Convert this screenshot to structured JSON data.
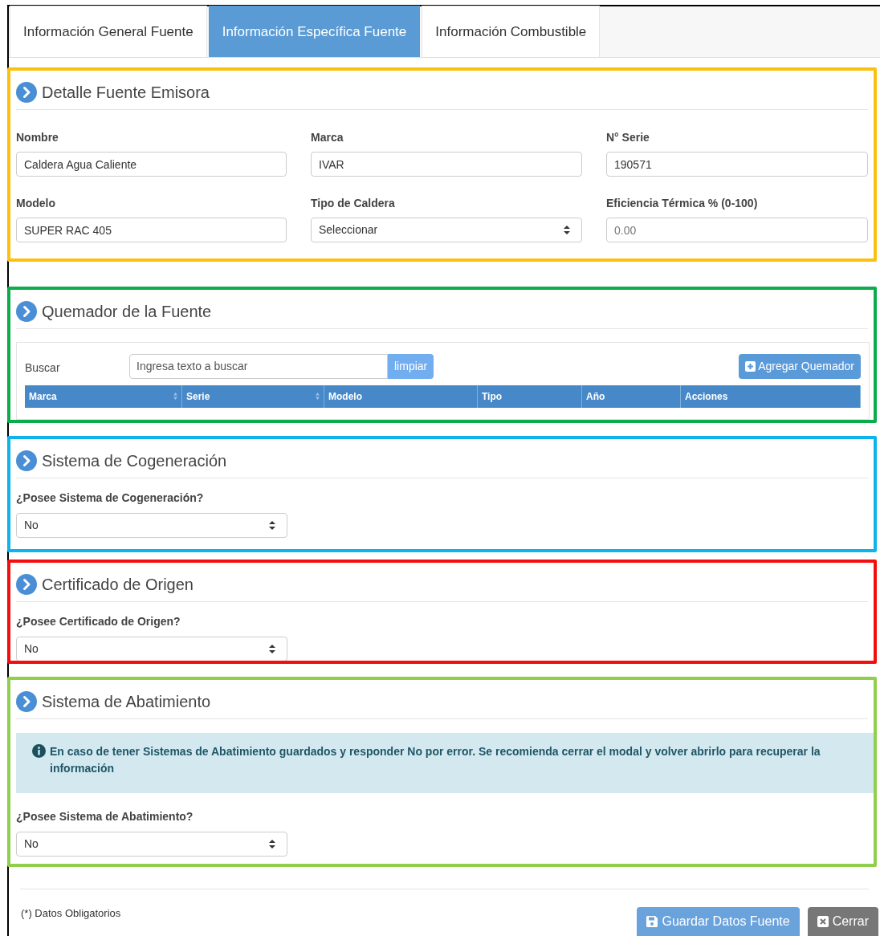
{
  "tabs": [
    {
      "label": "Información General Fuente",
      "selected": false
    },
    {
      "label": "Información Específica Fuente",
      "selected": true
    },
    {
      "label": "Información Combustible",
      "selected": false
    }
  ],
  "sections": [
    {
      "kind": "fields",
      "title": "Detalle Fuente Emisora",
      "color": "#fcc10f",
      "fields": [
        {
          "kind": "text",
          "label": "Nombre",
          "value": "Caldera Agua Caliente"
        },
        {
          "kind": "text",
          "label": "Marca",
          "value": "IVAR"
        },
        {
          "kind": "text",
          "label": "N° Serie",
          "value": "190571"
        },
        {
          "kind": "text",
          "label": "Modelo",
          "value": "SUPER RAC 405"
        },
        {
          "kind": "select",
          "label": "Tipo de Caldera",
          "value": "Seleccionar"
        },
        {
          "kind": "text",
          "label": "Eficiencia Térmica % (0-100)",
          "placeholder": "0.00"
        }
      ]
    },
    {
      "kind": "table",
      "title": "Quemador de la Fuente",
      "color": "#0cab4c",
      "search": {
        "label": "Buscar",
        "placeholder": "Ingresa texto a buscar",
        "clear": "limpiar"
      },
      "add_button": "Agregar Quemador",
      "columns": [
        {
          "label": "Marca",
          "sortable": true
        },
        {
          "label": "Serie",
          "sortable": true
        },
        {
          "label": "Modelo",
          "sortable": false
        },
        {
          "label": "Tipo",
          "sortable": false
        },
        {
          "label": "Año",
          "sortable": false
        },
        {
          "label": "Acciones",
          "sortable": false
        }
      ]
    },
    {
      "kind": "question",
      "title": "Sistema de Cogeneración",
      "color": "#0db4ec",
      "question": "¿Posee Sistema de Cogeneración?",
      "value": "No"
    },
    {
      "kind": "question",
      "title": "Certificado de Origen",
      "color": "#f40d0d",
      "question": "¿Posee Certificado de Origen?",
      "value": "No"
    },
    {
      "kind": "question",
      "title": "Sistema de Abatimiento",
      "color": "#8fcf4c",
      "alert": "En caso de tener Sistemas de Abatimiento guardados y responder No por error. Se recomienda cerrar el modal y volver abrirlo para recuperar la información",
      "question": "¿Posee Sistema de Abatimiento?",
      "value": "No"
    }
  ],
  "footer": {
    "note": "(*) Datos Obligatorios",
    "buttons": [
      {
        "kind": "save",
        "label": "Guardar Datos Fuente"
      },
      {
        "kind": "close",
        "label": "Cerrar"
      }
    ]
  }
}
